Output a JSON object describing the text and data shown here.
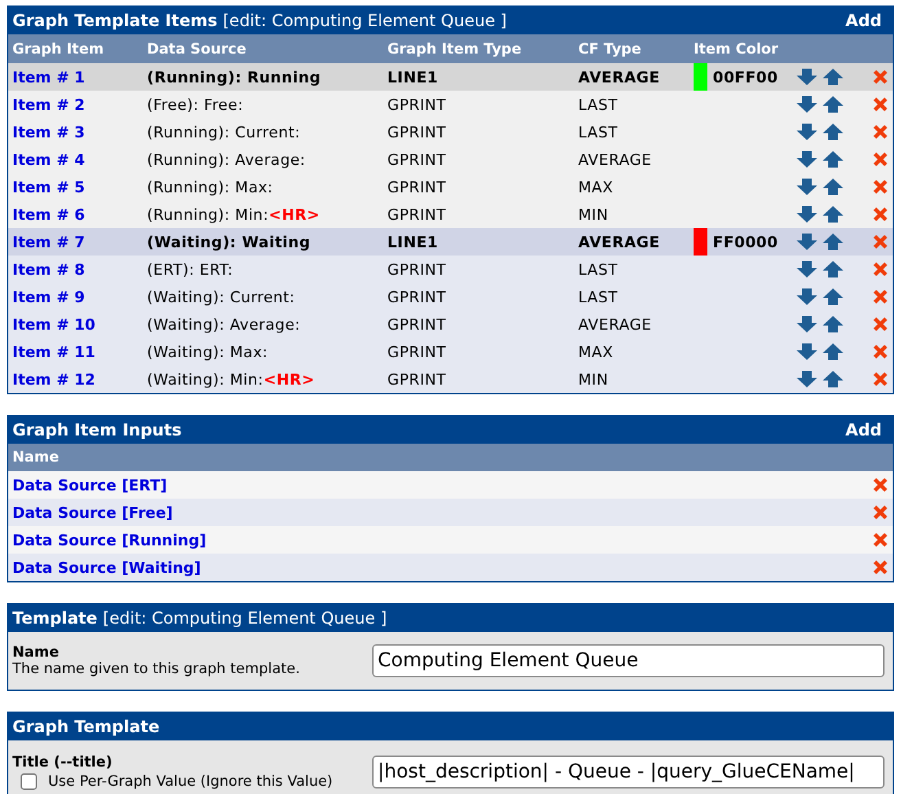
{
  "items_panel": {
    "title": "Graph Template Items",
    "subtitle": "[edit: Computing Element Queue ]",
    "add": "Add",
    "columns": [
      "Graph Item",
      "Data Source",
      "Graph Item Type",
      "CF Type",
      "Item Color"
    ],
    "groups": [
      {
        "items": [
          {
            "kind": "line",
            "item": "Item # 1",
            "data_source": "(Running): Running",
            "type": "LINE1",
            "cf": "AVERAGE",
            "item_color": "00FF00",
            "color": "#00ff00"
          },
          {
            "kind": "gprint",
            "item": "Item # 2",
            "data_source": "(Free): Free:",
            "type": "GPRINT",
            "cf": "LAST"
          },
          {
            "kind": "gprint",
            "item": "Item # 3",
            "data_source": "(Running): Current:",
            "type": "GPRINT",
            "cf": "LAST"
          },
          {
            "kind": "gprint",
            "item": "Item # 4",
            "data_source": "(Running): Average:",
            "type": "GPRINT",
            "cf": "AVERAGE"
          },
          {
            "kind": "gprint",
            "item": "Item # 5",
            "data_source": "(Running): Max:",
            "type": "GPRINT",
            "cf": "MAX"
          },
          {
            "kind": "gprint",
            "item": "Item # 6",
            "data_source": "(Running): Min:",
            "suffix": "<HR>",
            "type": "GPRINT",
            "cf": "MIN"
          }
        ]
      },
      {
        "items": [
          {
            "kind": "line",
            "item": "Item # 7",
            "data_source": "(Waiting): Waiting",
            "type": "LINE1",
            "cf": "AVERAGE",
            "item_color": "FF0000",
            "color": "#ff0000"
          },
          {
            "kind": "gprint",
            "item": "Item # 8",
            "data_source": "(ERT): ERT:",
            "type": "GPRINT",
            "cf": "LAST"
          },
          {
            "kind": "gprint",
            "item": "Item # 9",
            "data_source": "(Waiting): Current:",
            "type": "GPRINT",
            "cf": "LAST"
          },
          {
            "kind": "gprint",
            "item": "Item # 10",
            "data_source": "(Waiting): Average:",
            "type": "GPRINT",
            "cf": "AVERAGE"
          },
          {
            "kind": "gprint",
            "item": "Item # 11",
            "data_source": "(Waiting): Max:",
            "type": "GPRINT",
            "cf": "MAX"
          },
          {
            "kind": "gprint",
            "item": "Item # 12",
            "data_source": "(Waiting): Min:",
            "suffix": "<HR>",
            "type": "GPRINT",
            "cf": "MIN"
          }
        ]
      }
    ]
  },
  "inputs_panel": {
    "title": "Graph Item Inputs",
    "add": "Add",
    "column": "Name",
    "rows": [
      "Data Source [ERT]",
      "Data Source [Free]",
      "Data Source [Running]",
      "Data Source [Waiting]"
    ]
  },
  "template_panel": {
    "title": "Template",
    "subtitle": "[edit: Computing Element Queue ]",
    "field_label": "Name",
    "field_help": "The name given to this graph template.",
    "value": "Computing Element Queue"
  },
  "graph_panel": {
    "title": "Graph Template",
    "field_label": "Title (--title)",
    "checkbox_label": "Use Per-Graph Value (Ignore this Value)",
    "checked": false,
    "value": "|host_description| - Queue - |query_GlueCEName|"
  }
}
